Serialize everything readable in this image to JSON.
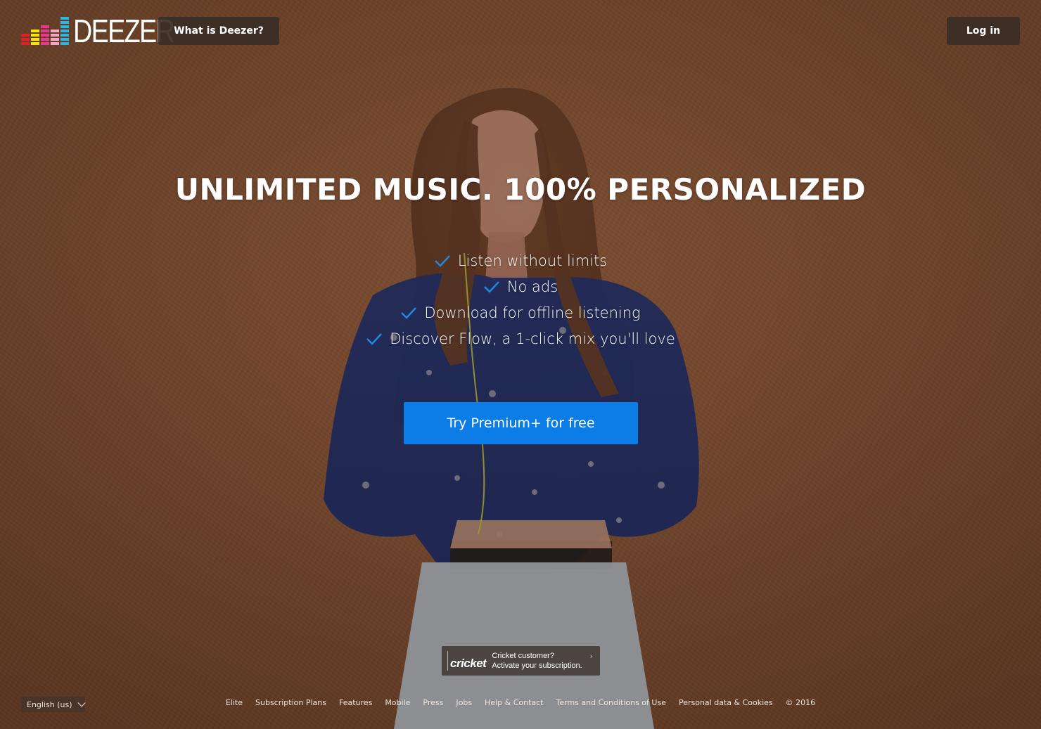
{
  "brand": {
    "name": "DEEZER",
    "logo_colors": [
      "#e11f26",
      "#f5e50b",
      "#e9378f",
      "#f2a7c8",
      "#2bb6e6"
    ]
  },
  "header": {
    "what_is_label": "What is Deezer?",
    "login_label": "Log in"
  },
  "hero": {
    "headline": "UNLIMITED MUSIC. 100% PERSONALIZED",
    "features": [
      "Listen without limits",
      "No ads",
      "Download for offline listening",
      "Discover Flow, a 1-click mix you'll love"
    ],
    "cta_label": "Try Premium+ for free"
  },
  "cricket": {
    "logo_text": "cricket",
    "line1": "Cricket customer?",
    "line2": "Activate your subscription.",
    "arrow": "›"
  },
  "footer": {
    "language": "English (us)",
    "links": [
      "Elite",
      "Subscription Plans",
      "Features",
      "Mobile",
      "Press",
      "Jobs",
      "Help & Contact",
      "Terms and Conditions of Use",
      "Personal data & Cookies"
    ],
    "copyright": "© 2016"
  },
  "colors": {
    "cta": "#0c7ce6",
    "check": "#1f8ae6",
    "dark_button": "#3a2c26"
  }
}
